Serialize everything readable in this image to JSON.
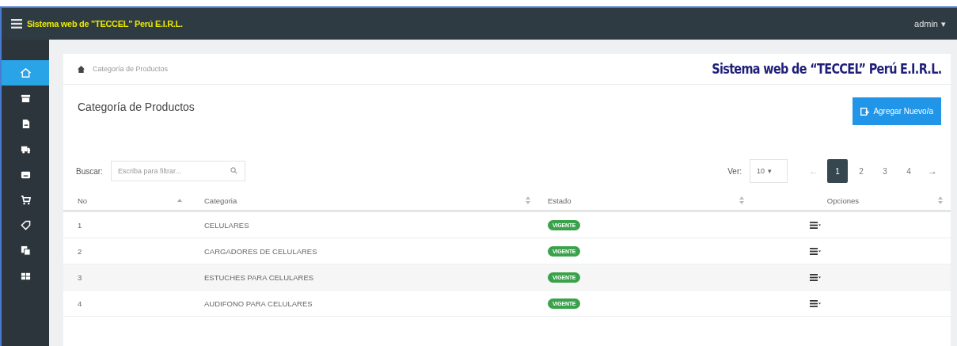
{
  "top_bar": {
    "title": "Sistema web de \"TECCEL\" Perú E.I.R.L.",
    "user": "admin",
    "user_caret": "▾"
  },
  "sidebar": {
    "items": [
      {
        "selected": true
      },
      {
        "selected": false
      },
      {
        "selected": false
      },
      {
        "selected": false
      },
      {
        "selected": false
      },
      {
        "selected": false
      },
      {
        "selected": false
      },
      {
        "selected": false
      },
      {
        "selected": false
      }
    ]
  },
  "breadcrumb": "Categoría de Productos",
  "brand": "Sistema web de “TECCEL” Perú E.I.R.L.",
  "heading": "Categoría de Productos",
  "add_button": "Agregar Nuevo/a",
  "search": {
    "label": "Buscar:",
    "placeholder": "Escriba para filtrar..."
  },
  "page_size": {
    "label": "Ver:",
    "value": "10",
    "caret": "▾"
  },
  "pagination": [
    {
      "label": "←",
      "kind": "arrow",
      "disabled": true,
      "selected": false
    },
    {
      "label": "1",
      "kind": "page",
      "disabled": false,
      "selected": true
    },
    {
      "label": "2",
      "kind": "page",
      "disabled": false,
      "selected": false
    },
    {
      "label": "3",
      "kind": "page",
      "disabled": false,
      "selected": false
    },
    {
      "label": "4",
      "kind": "page",
      "disabled": false,
      "selected": false
    },
    {
      "label": "→",
      "kind": "arrow",
      "disabled": false,
      "selected": false
    }
  ],
  "table": {
    "columns": [
      {
        "label": "No",
        "sorted": true
      },
      {
        "label": "Categoria",
        "sorted": false
      },
      {
        "label": "Estado",
        "sorted": false
      },
      {
        "label": "Opciones",
        "sorted": false
      }
    ],
    "rows": [
      {
        "no": "1",
        "categoria": "CELULARES",
        "estado": "VIGENTE"
      },
      {
        "no": "2",
        "categoria": "CARGADORES DE CELULARES",
        "estado": "VIGENTE"
      },
      {
        "no": "3",
        "categoria": "ESTUCHES PARA CELULARES",
        "estado": "VIGENTE"
      },
      {
        "no": "4",
        "categoria": "AUDIFONO PARA CELULARES",
        "estado": "VIGENTE"
      }
    ]
  }
}
